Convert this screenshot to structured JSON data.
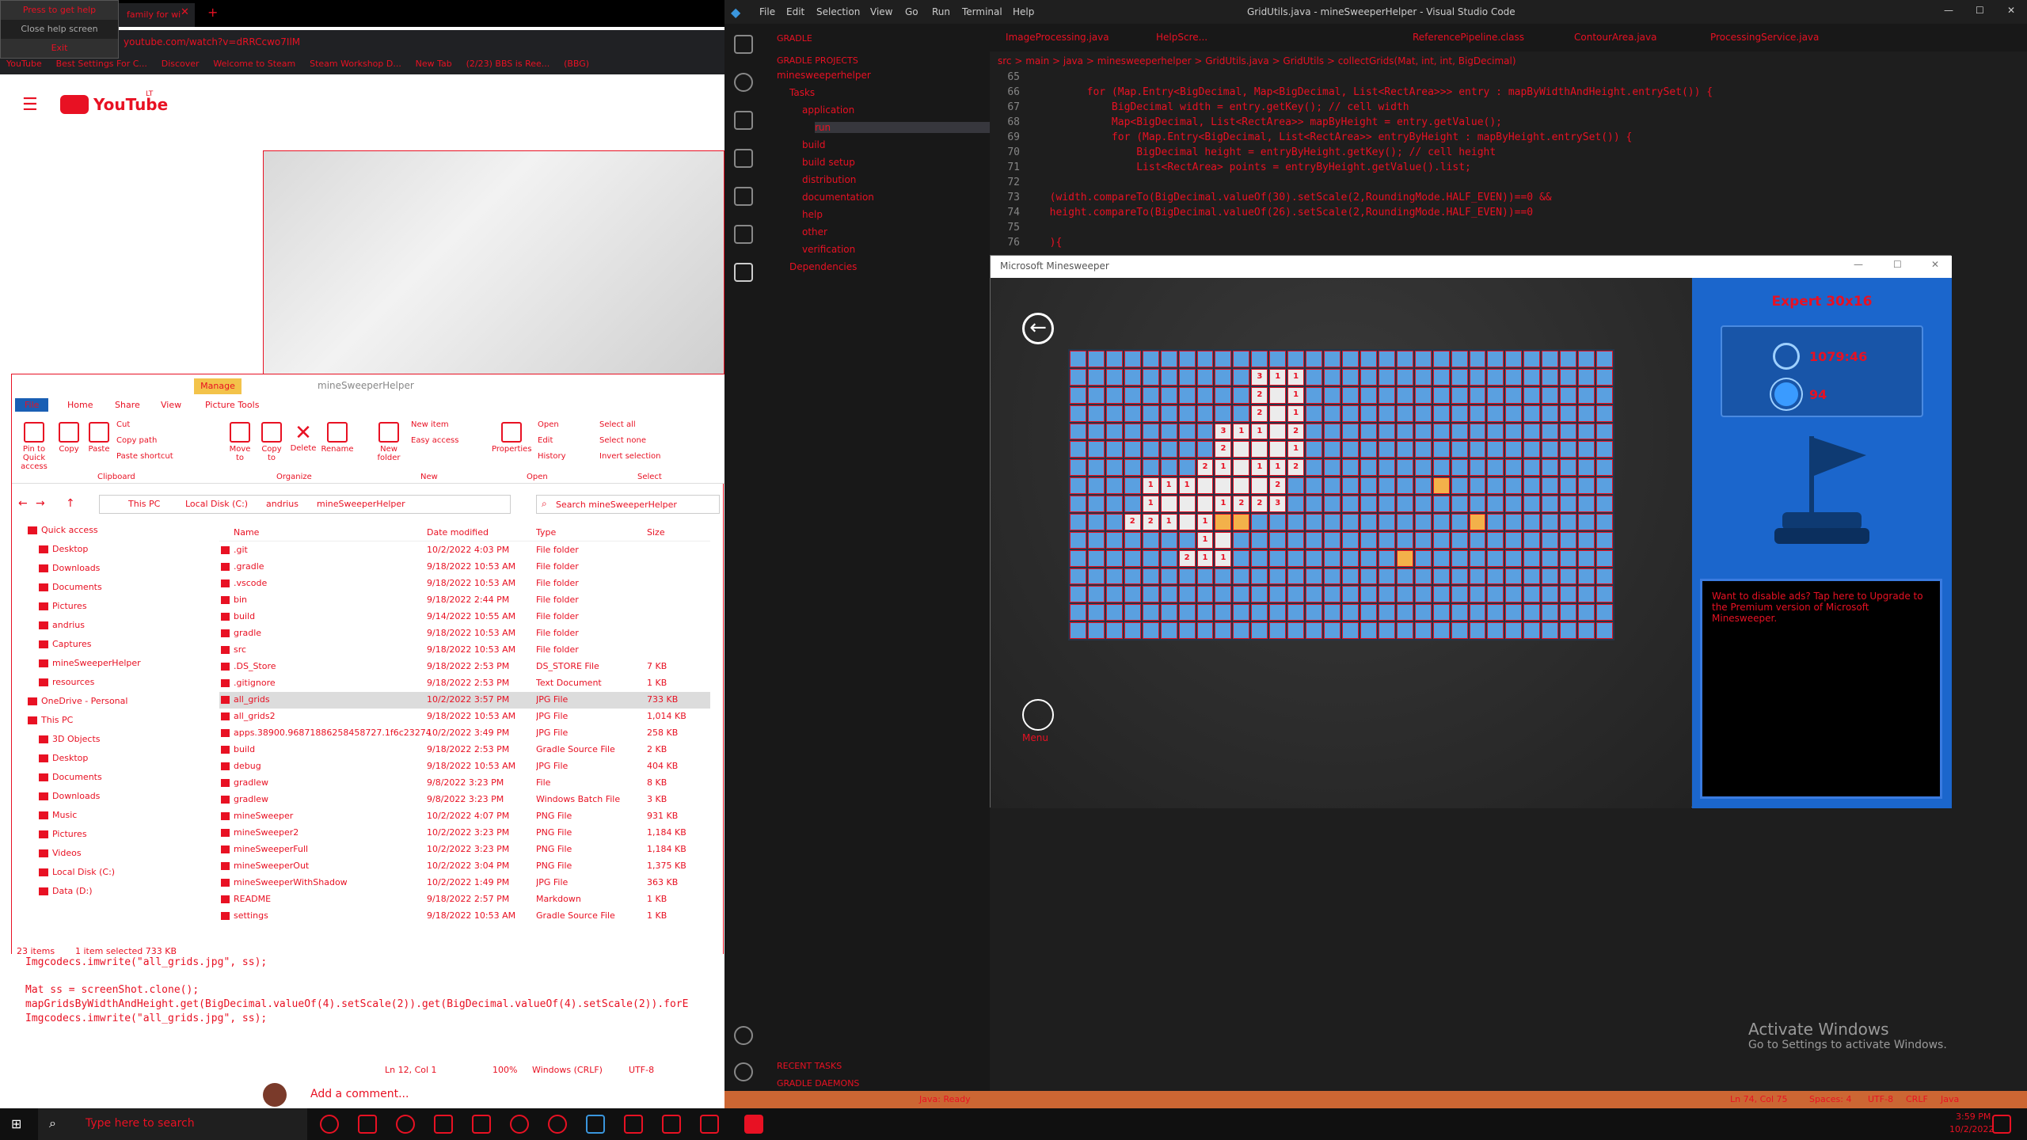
{
  "browser": {
    "help_menu": [
      "Press to get help",
      "Close help screen",
      "Exit"
    ],
    "tabs": [
      {
        "label": "family for wi"
      }
    ],
    "new_tab": "+",
    "address": "youtube.com/watch?v=dRRCcwo7IlM",
    "bookmarks": [
      "YouTube",
      "Best Settings For C...",
      "Discover",
      "Welcome to Steam",
      "Steam Workshop D...",
      "New Tab",
      "(2/23) BBS is Ree...",
      "(BBG)"
    ],
    "youtube_logo": "YouTube",
    "youtube_region": "LT"
  },
  "explorer": {
    "title": "mineSweeperHelper",
    "manage_tab": "Manage",
    "ribbon_tabs": [
      "File",
      "Home",
      "Share",
      "View",
      "Picture Tools"
    ],
    "ribbon_buttons": [
      "Pin to Quick access",
      "Copy",
      "Paste",
      "Cut",
      "Copy path",
      "Paste shortcut",
      "Move to",
      "Copy to",
      "Delete",
      "Rename",
      "New folder",
      "New item",
      "Easy access",
      "Properties",
      "Open",
      "Edit",
      "History",
      "Select all",
      "Select none",
      "Invert selection"
    ],
    "ribbon_groups": [
      "Clipboard",
      "Organize",
      "New",
      "Open",
      "Select"
    ],
    "path": [
      "This PC",
      "Local Disk (C:)",
      "andrius",
      "mineSweeperHelper"
    ],
    "search_placeholder": "Search mineSweeperHelper",
    "tree": [
      {
        "label": "Quick access",
        "indent": 0
      },
      {
        "label": "Desktop",
        "indent": 1
      },
      {
        "label": "Downloads",
        "indent": 1
      },
      {
        "label": "Documents",
        "indent": 1
      },
      {
        "label": "Pictures",
        "indent": 1
      },
      {
        "label": "andrius",
        "indent": 1
      },
      {
        "label": "Captures",
        "indent": 1
      },
      {
        "label": "mineSweeperHelper",
        "indent": 1
      },
      {
        "label": "resources",
        "indent": 1
      },
      {
        "label": "OneDrive - Personal",
        "indent": 0
      },
      {
        "label": "This PC",
        "indent": 0
      },
      {
        "label": "3D Objects",
        "indent": 1
      },
      {
        "label": "Desktop",
        "indent": 1
      },
      {
        "label": "Documents",
        "indent": 1
      },
      {
        "label": "Downloads",
        "indent": 1
      },
      {
        "label": "Music",
        "indent": 1
      },
      {
        "label": "Pictures",
        "indent": 1
      },
      {
        "label": "Videos",
        "indent": 1
      },
      {
        "label": "Local Disk (C:)",
        "indent": 1
      },
      {
        "label": "Data (D:)",
        "indent": 1
      }
    ],
    "columns": [
      "Name",
      "Date modified",
      "Type",
      "Size"
    ],
    "files": [
      {
        "name": ".git",
        "date": "10/2/2022 4:03 PM",
        "type": "File folder",
        "size": ""
      },
      {
        "name": ".gradle",
        "date": "9/18/2022 10:53 AM",
        "type": "File folder",
        "size": ""
      },
      {
        "name": ".vscode",
        "date": "9/18/2022 10:53 AM",
        "type": "File folder",
        "size": ""
      },
      {
        "name": "bin",
        "date": "9/18/2022 2:44 PM",
        "type": "File folder",
        "size": ""
      },
      {
        "name": "build",
        "date": "9/14/2022 10:55 AM",
        "type": "File folder",
        "size": ""
      },
      {
        "name": "gradle",
        "date": "9/18/2022 10:53 AM",
        "type": "File folder",
        "size": ""
      },
      {
        "name": "src",
        "date": "9/18/2022 10:53 AM",
        "type": "File folder",
        "size": ""
      },
      {
        "name": ".DS_Store",
        "date": "9/18/2022 2:53 PM",
        "type": "DS_STORE File",
        "size": "7 KB"
      },
      {
        "name": ".gitignore",
        "date": "9/18/2022 2:53 PM",
        "type": "Text Document",
        "size": "1 KB"
      },
      {
        "name": "all_grids",
        "date": "10/2/2022 3:57 PM",
        "type": "JPG File",
        "size": "733 KB"
      },
      {
        "name": "all_grids2",
        "date": "9/18/2022 10:53 AM",
        "type": "JPG File",
        "size": "1,014 KB"
      },
      {
        "name": "apps.38900.96871886258458727.1f6c23274-5...",
        "date": "10/2/2022 3:49 PM",
        "type": "JPG File",
        "size": "258 KB"
      },
      {
        "name": "build",
        "date": "9/18/2022 2:53 PM",
        "type": "Gradle Source File",
        "size": "2 KB"
      },
      {
        "name": "debug",
        "date": "9/18/2022 10:53 AM",
        "type": "JPG File",
        "size": "404 KB"
      },
      {
        "name": "gradlew",
        "date": "9/8/2022 3:23 PM",
        "type": "File",
        "size": "8 KB"
      },
      {
        "name": "gradlew",
        "date": "9/8/2022 3:23 PM",
        "type": "Windows Batch File",
        "size": "3 KB"
      },
      {
        "name": "mineSweeper",
        "date": "10/2/2022 4:07 PM",
        "type": "PNG File",
        "size": "931 KB"
      },
      {
        "name": "mineSweeper2",
        "date": "10/2/2022 3:23 PM",
        "type": "PNG File",
        "size": "1,184 KB"
      },
      {
        "name": "mineSweeperFull",
        "date": "10/2/2022 3:23 PM",
        "type": "PNG File",
        "size": "1,184 KB"
      },
      {
        "name": "mineSweeperOut",
        "date": "10/2/2022 3:04 PM",
        "type": "PNG File",
        "size": "1,375 KB"
      },
      {
        "name": "mineSweeperWithShadow",
        "date": "10/2/2022 1:49 PM",
        "type": "JPG File",
        "size": "363 KB"
      },
      {
        "name": "README",
        "date": "9/18/2022 2:57 PM",
        "type": "Markdown",
        "size": "1 KB"
      },
      {
        "name": "settings",
        "date": "9/18/2022 10:53 AM",
        "type": "Gradle Source File",
        "size": "1 KB"
      }
    ],
    "selected_file": "all_grids",
    "status_items": "23 items",
    "status_selected": "1 item selected  733 KB"
  },
  "left_code": [
    "Imgcodecs.imwrite(\"all_grids.jpg\", ss);",
    "",
    "Mat ss = screenShot.clone();",
    "mapGridsByWidthAndHeight.get(BigDecimal.valueOf(4).setScale(2)).get(BigDecimal.valueOf(4).setScale(2)).forE",
    "Imgcodecs.imwrite(\"all_grids.jpg\", ss);"
  ],
  "left_status": [
    "Ln 12, Col 1",
    "100%",
    "Windows (CRLF)",
    "UTF-8"
  ],
  "comment_prompt": "Add a comment...",
  "vscode": {
    "window_title": "GridUtils.java - mineSweeperHelper - Visual Studio Code",
    "menu": [
      "File",
      "Edit",
      "Selection",
      "View",
      "Go",
      "Run",
      "Terminal",
      "Help"
    ],
    "sidebar_title": "GRADLE",
    "sidebar_section": "GRADLE PROJECTS",
    "gradle_tree": [
      {
        "label": "minesweeperhelper",
        "indent": 0
      },
      {
        "label": "Tasks",
        "indent": 1
      },
      {
        "label": "application",
        "indent": 2
      },
      {
        "label": "run",
        "indent": 3
      },
      {
        "label": "build",
        "indent": 2
      },
      {
        "label": "build setup",
        "indent": 2
      },
      {
        "label": "distribution",
        "indent": 2
      },
      {
        "label": "documentation",
        "indent": 2
      },
      {
        "label": "help",
        "indent": 2
      },
      {
        "label": "other",
        "indent": 2
      },
      {
        "label": "verification",
        "indent": 2
      },
      {
        "label": "Dependencies",
        "indent": 1
      }
    ],
    "recent_tasks": "RECENT TASKS",
    "gradle_daemons": "GRADLE DAEMONS",
    "editor_tabs": [
      "ImageProcessing.java",
      "HelpScre...",
      "ReferencePipeline.class",
      "ContourArea.java",
      "ProcessingService.java"
    ],
    "breadcrumb": "src > main > java > minesweeperhelper > GridUtils.java > GridUtils > collectGrids(Mat, int, int, BigDecimal)",
    "code_lines": [
      {
        "n": "65",
        "text": ""
      },
      {
        "n": "66",
        "text": "        for (Map.Entry<BigDecimal, Map<BigDecimal, List<RectArea>>> entry : mapByWidthAndHeight.entrySet()) {"
      },
      {
        "n": "67",
        "text": "            BigDecimal width = entry.getKey(); // cell width"
      },
      {
        "n": "68",
        "text": "            Map<BigDecimal, List<RectArea>> mapByHeight = entry.getValue();"
      },
      {
        "n": "69",
        "text": "            for (Map.Entry<BigDecimal, List<RectArea>> entryByHeight : mapByHeight.entrySet()) {"
      },
      {
        "n": "70",
        "text": "                BigDecimal height = entryByHeight.getKey(); // cell height"
      },
      {
        "n": "71",
        "text": "                List<RectArea> points = entryByHeight.getValue().list;"
      },
      {
        "n": "72",
        "text": ""
      },
      {
        "n": "73",
        "text": "  (width.compareTo(BigDecimal.valueOf(30).setScale(2,RoundingMode.HALF_EVEN))==0 &&"
      },
      {
        "n": "74",
        "text": "  height.compareTo(BigDecimal.valueOf(26).setScale(2,RoundingMode.HALF_EVEN))==0"
      },
      {
        "n": "75",
        "text": ""
      },
      {
        "n": "76",
        "text": "  ){"
      }
    ],
    "status_left": "Java: Ready",
    "status_right": [
      "Ln 74, Col 75",
      "Spaces: 4",
      "UTF-8",
      "CRLF",
      "Java"
    ],
    "activate_windows": "Activate Windows",
    "activate_windows_sub": "Go to Settings to activate Windows."
  },
  "minesweeper": {
    "title": "Microsoft Minesweeper",
    "back_symbol": "←",
    "menu_label": "Menu",
    "mode": "Expert 30x16",
    "timer": "1079:46",
    "mines_left": "94",
    "ad_text": "Want to disable ads? Tap here to Upgrade to the Premium version of Microsoft Minesweeper.",
    "grid_cols": 30,
    "grid_rows": 16,
    "cells": [
      {
        "r": 1,
        "c": 10,
        "v": "3",
        "s": "open"
      },
      {
        "r": 1,
        "c": 11,
        "v": "1",
        "s": "open"
      },
      {
        "r": 1,
        "c": 12,
        "v": "1",
        "s": "open"
      },
      {
        "r": 2,
        "c": 10,
        "v": "2",
        "s": "open"
      },
      {
        "r": 2,
        "c": 11,
        "v": "",
        "s": "open"
      },
      {
        "r": 2,
        "c": 12,
        "v": "1",
        "s": "open"
      },
      {
        "r": 3,
        "c": 10,
        "v": "2",
        "s": "open"
      },
      {
        "r": 3,
        "c": 11,
        "v": "",
        "s": "open"
      },
      {
        "r": 3,
        "c": 12,
        "v": "1",
        "s": "open"
      },
      {
        "r": 4,
        "c": 8,
        "v": "3",
        "s": "open"
      },
      {
        "r": 4,
        "c": 9,
        "v": "1",
        "s": "open"
      },
      {
        "r": 4,
        "c": 10,
        "v": "1",
        "s": "open"
      },
      {
        "r": 4,
        "c": 11,
        "v": "",
        "s": "open"
      },
      {
        "r": 4,
        "c": 12,
        "v": "2",
        "s": "open"
      },
      {
        "r": 5,
        "c": 8,
        "v": "2",
        "s": "open"
      },
      {
        "r": 5,
        "c": 9,
        "v": "",
        "s": "open"
      },
      {
        "r": 5,
        "c": 10,
        "v": "",
        "s": "open"
      },
      {
        "r": 5,
        "c": 11,
        "v": "",
        "s": "open"
      },
      {
        "r": 5,
        "c": 12,
        "v": "1",
        "s": "open"
      },
      {
        "r": 6,
        "c": 7,
        "v": "2",
        "s": "open"
      },
      {
        "r": 6,
        "c": 8,
        "v": "1",
        "s": "open"
      },
      {
        "r": 6,
        "c": 9,
        "v": "",
        "s": "open"
      },
      {
        "r": 6,
        "c": 10,
        "v": "1",
        "s": "open"
      },
      {
        "r": 6,
        "c": 11,
        "v": "1",
        "s": "open"
      },
      {
        "r": 6,
        "c": 12,
        "v": "2",
        "s": "open"
      },
      {
        "r": 7,
        "c": 4,
        "v": "1",
        "s": "open"
      },
      {
        "r": 7,
        "c": 5,
        "v": "1",
        "s": "open"
      },
      {
        "r": 7,
        "c": 6,
        "v": "1",
        "s": "open"
      },
      {
        "r": 7,
        "c": 7,
        "v": "",
        "s": "open"
      },
      {
        "r": 7,
        "c": 8,
        "v": "",
        "s": "open"
      },
      {
        "r": 7,
        "c": 9,
        "v": "",
        "s": "open"
      },
      {
        "r": 7,
        "c": 10,
        "v": "",
        "s": "open"
      },
      {
        "r": 7,
        "c": 11,
        "v": "2",
        "s": "open"
      },
      {
        "r": 7,
        "c": 20,
        "v": "",
        "s": "flag"
      },
      {
        "r": 8,
        "c": 4,
        "v": "1",
        "s": "open"
      },
      {
        "r": 8,
        "c": 5,
        "v": "",
        "s": "open"
      },
      {
        "r": 8,
        "c": 6,
        "v": "",
        "s": "open"
      },
      {
        "r": 8,
        "c": 7,
        "v": "",
        "s": "open"
      },
      {
        "r": 8,
        "c": 8,
        "v": "1",
        "s": "open"
      },
      {
        "r": 8,
        "c": 9,
        "v": "2",
        "s": "open"
      },
      {
        "r": 8,
        "c": 10,
        "v": "2",
        "s": "open"
      },
      {
        "r": 8,
        "c": 11,
        "v": "3",
        "s": "open"
      },
      {
        "r": 9,
        "c": 3,
        "v": "2",
        "s": "open"
      },
      {
        "r": 9,
        "c": 4,
        "v": "2",
        "s": "open"
      },
      {
        "r": 9,
        "c": 5,
        "v": "1",
        "s": "open"
      },
      {
        "r": 9,
        "c": 6,
        "v": "",
        "s": "open"
      },
      {
        "r": 9,
        "c": 7,
        "v": "1",
        "s": "open"
      },
      {
        "r": 9,
        "c": 8,
        "v": "",
        "s": "flag"
      },
      {
        "r": 9,
        "c": 9,
        "v": "",
        "s": "flag"
      },
      {
        "r": 9,
        "c": 22,
        "v": "",
        "s": "flag"
      },
      {
        "r": 10,
        "c": 7,
        "v": "1",
        "s": "open"
      },
      {
        "r": 10,
        "c": 8,
        "v": "",
        "s": "open"
      },
      {
        "r": 11,
        "c": 6,
        "v": "2",
        "s": "open"
      },
      {
        "r": 11,
        "c": 7,
        "v": "1",
        "s": "open"
      },
      {
        "r": 11,
        "c": 8,
        "v": "1",
        "s": "open"
      },
      {
        "r": 11,
        "c": 18,
        "v": "",
        "s": "flag"
      }
    ]
  },
  "taskbar": {
    "search_placeholder": "Type here to search",
    "time": "3:59 PM",
    "date": "10/2/2022"
  }
}
